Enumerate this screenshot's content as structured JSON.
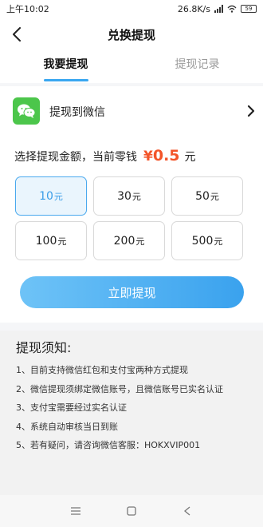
{
  "status_bar": {
    "time": "上午10:02",
    "speed": "26.8K/s",
    "battery": "59"
  },
  "header": {
    "title": "兑换提现"
  },
  "tabs": [
    {
      "label": "我要提现",
      "active": true
    },
    {
      "label": "提现记录",
      "active": false
    }
  ],
  "method": {
    "label": "提现到微信",
    "icon": "wechat-icon"
  },
  "amount": {
    "prefix": "选择提现金额，当前零钱",
    "currency": "¥",
    "value": "0.5",
    "unit": "元"
  },
  "options": [
    {
      "num": "10",
      "unit": "元",
      "selected": true
    },
    {
      "num": "30",
      "unit": "元",
      "selected": false
    },
    {
      "num": "50",
      "unit": "元",
      "selected": false
    },
    {
      "num": "100",
      "unit": "元",
      "selected": false
    },
    {
      "num": "200",
      "unit": "元",
      "selected": false
    },
    {
      "num": "500",
      "unit": "元",
      "selected": false
    }
  ],
  "withdraw_button": "立即提现",
  "notice": {
    "title": "提现须知:",
    "items": [
      "1、目前支持微信红包和支付宝两种方式提现",
      "2、微信提现须绑定微信账号，且微信账号已实名认证",
      "3、支付宝需要经过实名认证",
      "4、系统自动审核当日到账",
      "5、若有疑问，请咨询微信客服：HOKXVIP001"
    ]
  },
  "colors": {
    "accent": "#3aa2ee",
    "price": "#f3552a",
    "wechat": "#4cc64b"
  }
}
